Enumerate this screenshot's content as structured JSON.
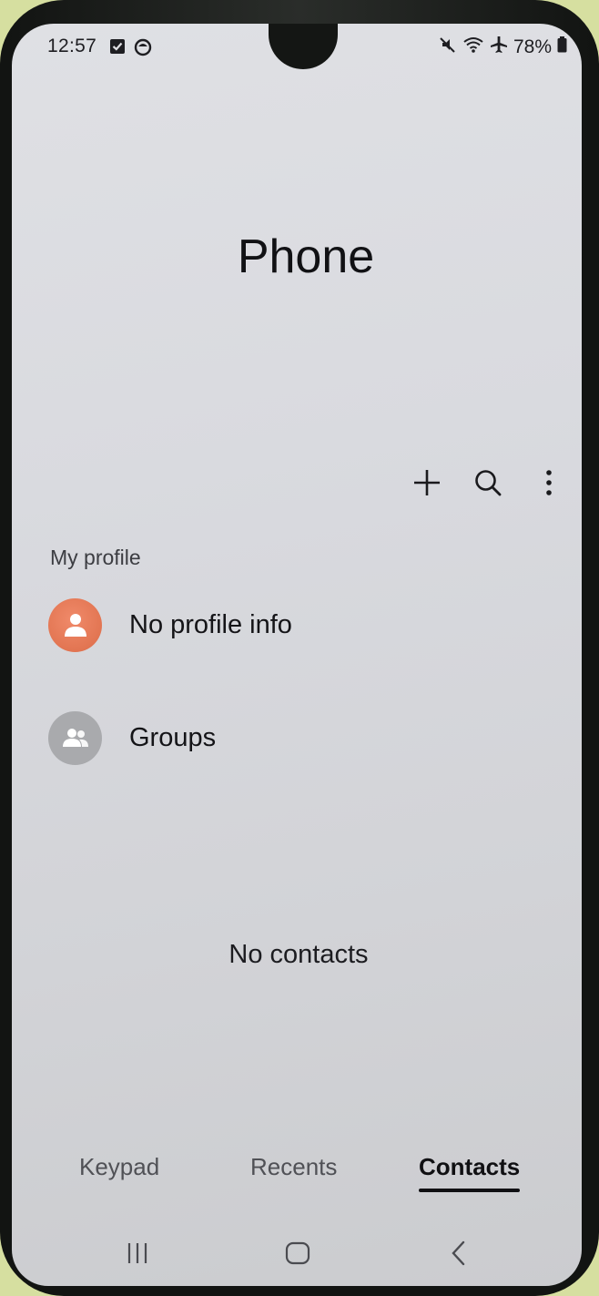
{
  "status_bar": {
    "time": "12:57",
    "left_icons": [
      "checkbox-notification-icon",
      "app-notification-icon"
    ],
    "right_icons": [
      "mute-icon",
      "wifi-icon",
      "airplane-mode-icon"
    ],
    "battery_percent": "78%"
  },
  "header": {
    "title": "Phone"
  },
  "toolbar": {
    "icons": [
      "plus-icon",
      "search-icon",
      "more-options-icon"
    ]
  },
  "profile_section": {
    "label": "My profile",
    "profile_row_label": "No profile info",
    "groups_row_label": "Groups"
  },
  "contacts": {
    "empty_message": "No contacts"
  },
  "bottom_tabs": {
    "items": [
      {
        "label": "Keypad",
        "active": false
      },
      {
        "label": "Recents",
        "active": false
      },
      {
        "label": "Contacts",
        "active": true
      }
    ]
  },
  "nav_bar": {
    "buttons": [
      "recent-apps-icon",
      "home-icon",
      "back-icon"
    ]
  },
  "colors": {
    "profile_avatar": "#e27552",
    "groups_avatar": "#a9aaad",
    "screen_background": "#d9dadf"
  }
}
